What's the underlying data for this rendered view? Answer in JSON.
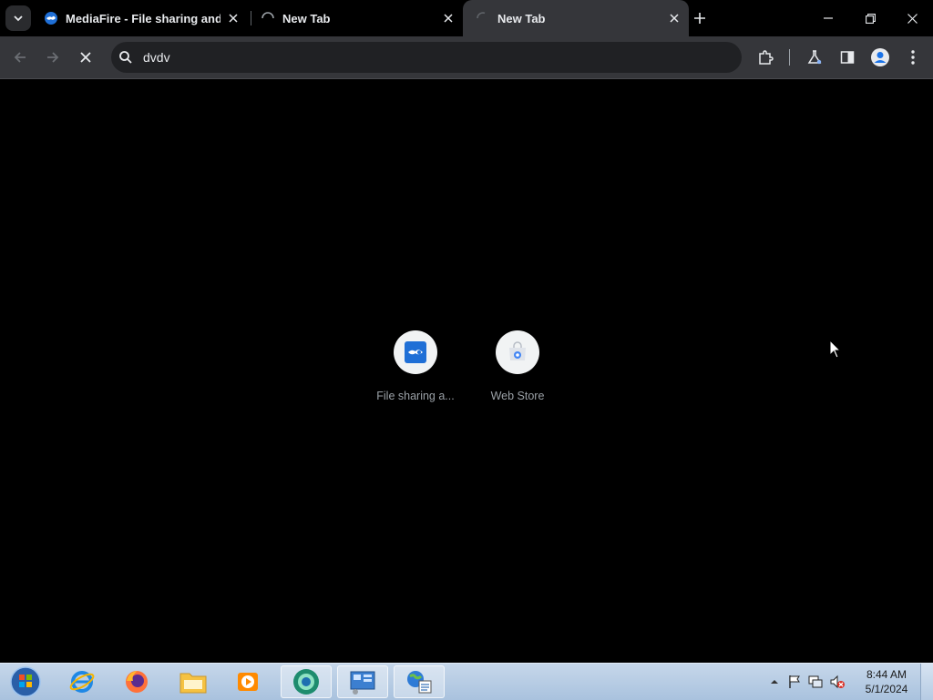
{
  "tabs": [
    {
      "title": "MediaFire - File sharing and storage made simple",
      "active": false
    },
    {
      "title": "New Tab",
      "active": false,
      "loading": true
    },
    {
      "title": "New Tab",
      "active": true
    }
  ],
  "omnibox": {
    "value": "dvdv"
  },
  "shortcuts": [
    {
      "label": "File sharing a...",
      "icon": "mediafire-icon"
    },
    {
      "label": "Web Store",
      "icon": "web-store-icon"
    }
  ],
  "taskbar": {
    "apps": [
      "start-orb",
      "internet-explorer",
      "firefox",
      "file-explorer",
      "media-player",
      "chrome-canary",
      "control-panel",
      "network-app"
    ],
    "time": "8:44 AM",
    "date": "5/1/2024"
  },
  "colors": {
    "tabbar_bg": "#000000",
    "toolbar_bg": "#35363a",
    "omnibox_bg": "#202124",
    "content_bg": "#000000",
    "text": "#e8eaed"
  }
}
